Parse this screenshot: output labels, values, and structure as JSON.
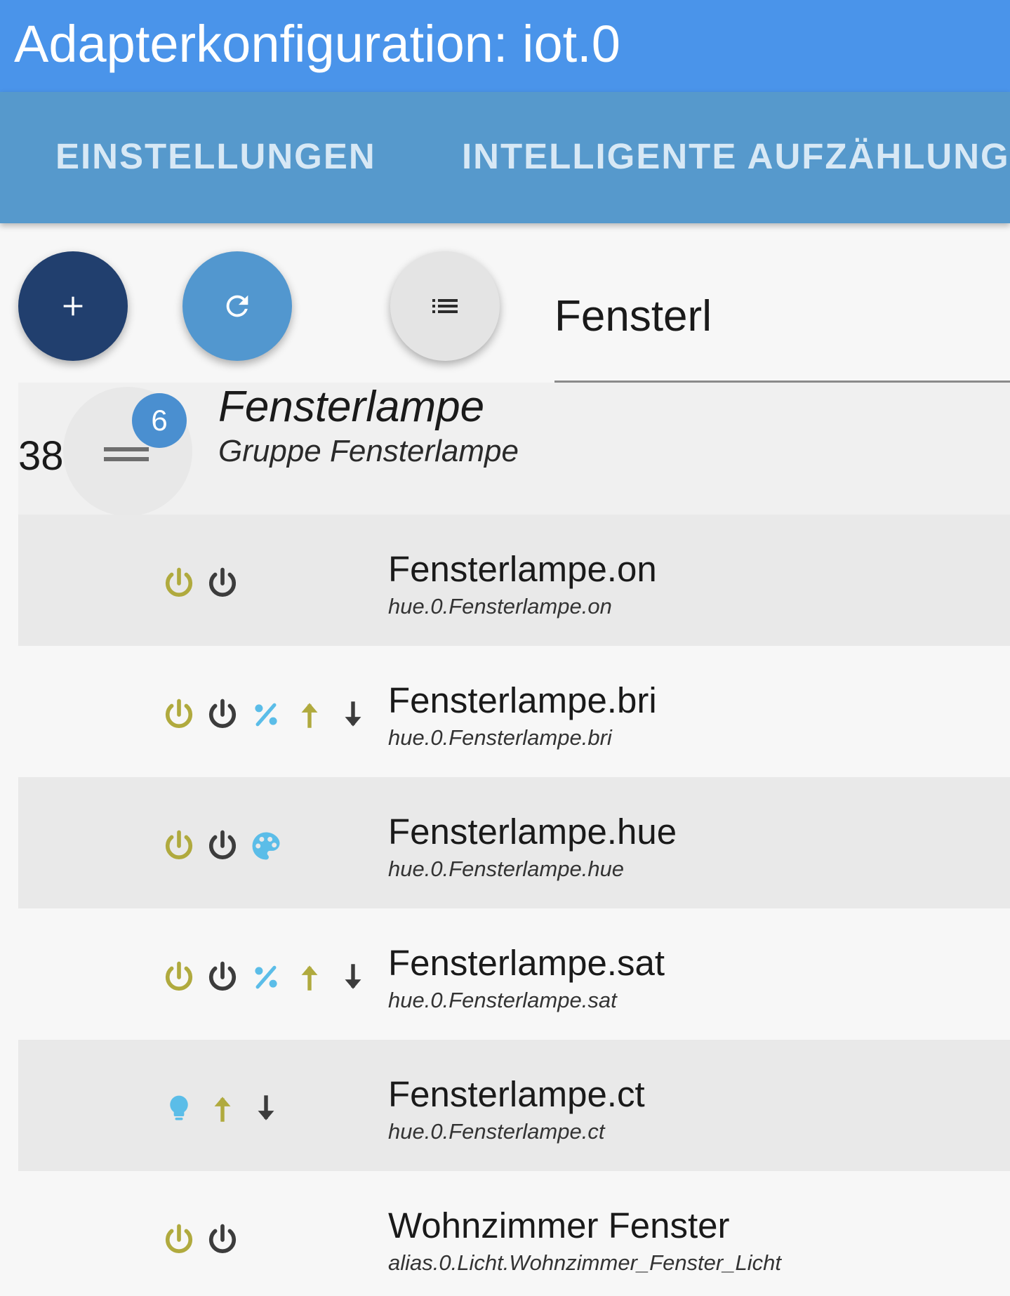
{
  "window": {
    "title": "Adapterkonfiguration: iot.0"
  },
  "tabs": [
    {
      "label": "EINSTELLUNGEN"
    },
    {
      "label": "INTELLIGENTE AUFZÄHLUNGE"
    }
  ],
  "toolbar": {
    "add_icon": "plus-icon",
    "refresh_icon": "refresh-icon",
    "list_icon": "list-icon"
  },
  "search": {
    "value": "Fensterl"
  },
  "group": {
    "number": "38.",
    "badge_count": "6",
    "name": "Fensterlampe",
    "description": "Gruppe Fensterlampe"
  },
  "devices": [
    {
      "name": "Fensterlampe.on",
      "id": "hue.0.Fensterlampe.on",
      "icons": [
        "power-on-icon",
        "power-off-icon"
      ]
    },
    {
      "name": "Fensterlampe.bri",
      "id": "hue.0.Fensterlampe.bri",
      "icons": [
        "power-on-icon",
        "power-off-icon",
        "percent-icon",
        "arrow-up-icon",
        "arrow-down-icon"
      ]
    },
    {
      "name": "Fensterlampe.hue",
      "id": "hue.0.Fensterlampe.hue",
      "icons": [
        "power-on-icon",
        "power-off-icon",
        "palette-icon"
      ]
    },
    {
      "name": "Fensterlampe.sat",
      "id": "hue.0.Fensterlampe.sat",
      "icons": [
        "power-on-icon",
        "power-off-icon",
        "percent-icon",
        "arrow-up-icon",
        "arrow-down-icon"
      ]
    },
    {
      "name": "Fensterlampe.ct",
      "id": "hue.0.Fensterlampe.ct",
      "icons": [
        "lightbulb-icon",
        "arrow-up-icon",
        "arrow-down-icon"
      ]
    },
    {
      "name": "Wohnzimmer Fenster",
      "id": "alias.0.Licht.Wohnzimmer_Fenster_Licht",
      "icons": [
        "power-on-icon",
        "power-off-icon"
      ]
    }
  ],
  "colors": {
    "header": "#4a94ea",
    "tabbar": "#5699cc",
    "fab_add": "#213f6e",
    "fab_refresh": "#5297cf",
    "badge": "#4a8fd0",
    "icon_olive": "#b0aa3e",
    "icon_dark": "#3c3c3c",
    "icon_blue": "#5bbde8"
  }
}
